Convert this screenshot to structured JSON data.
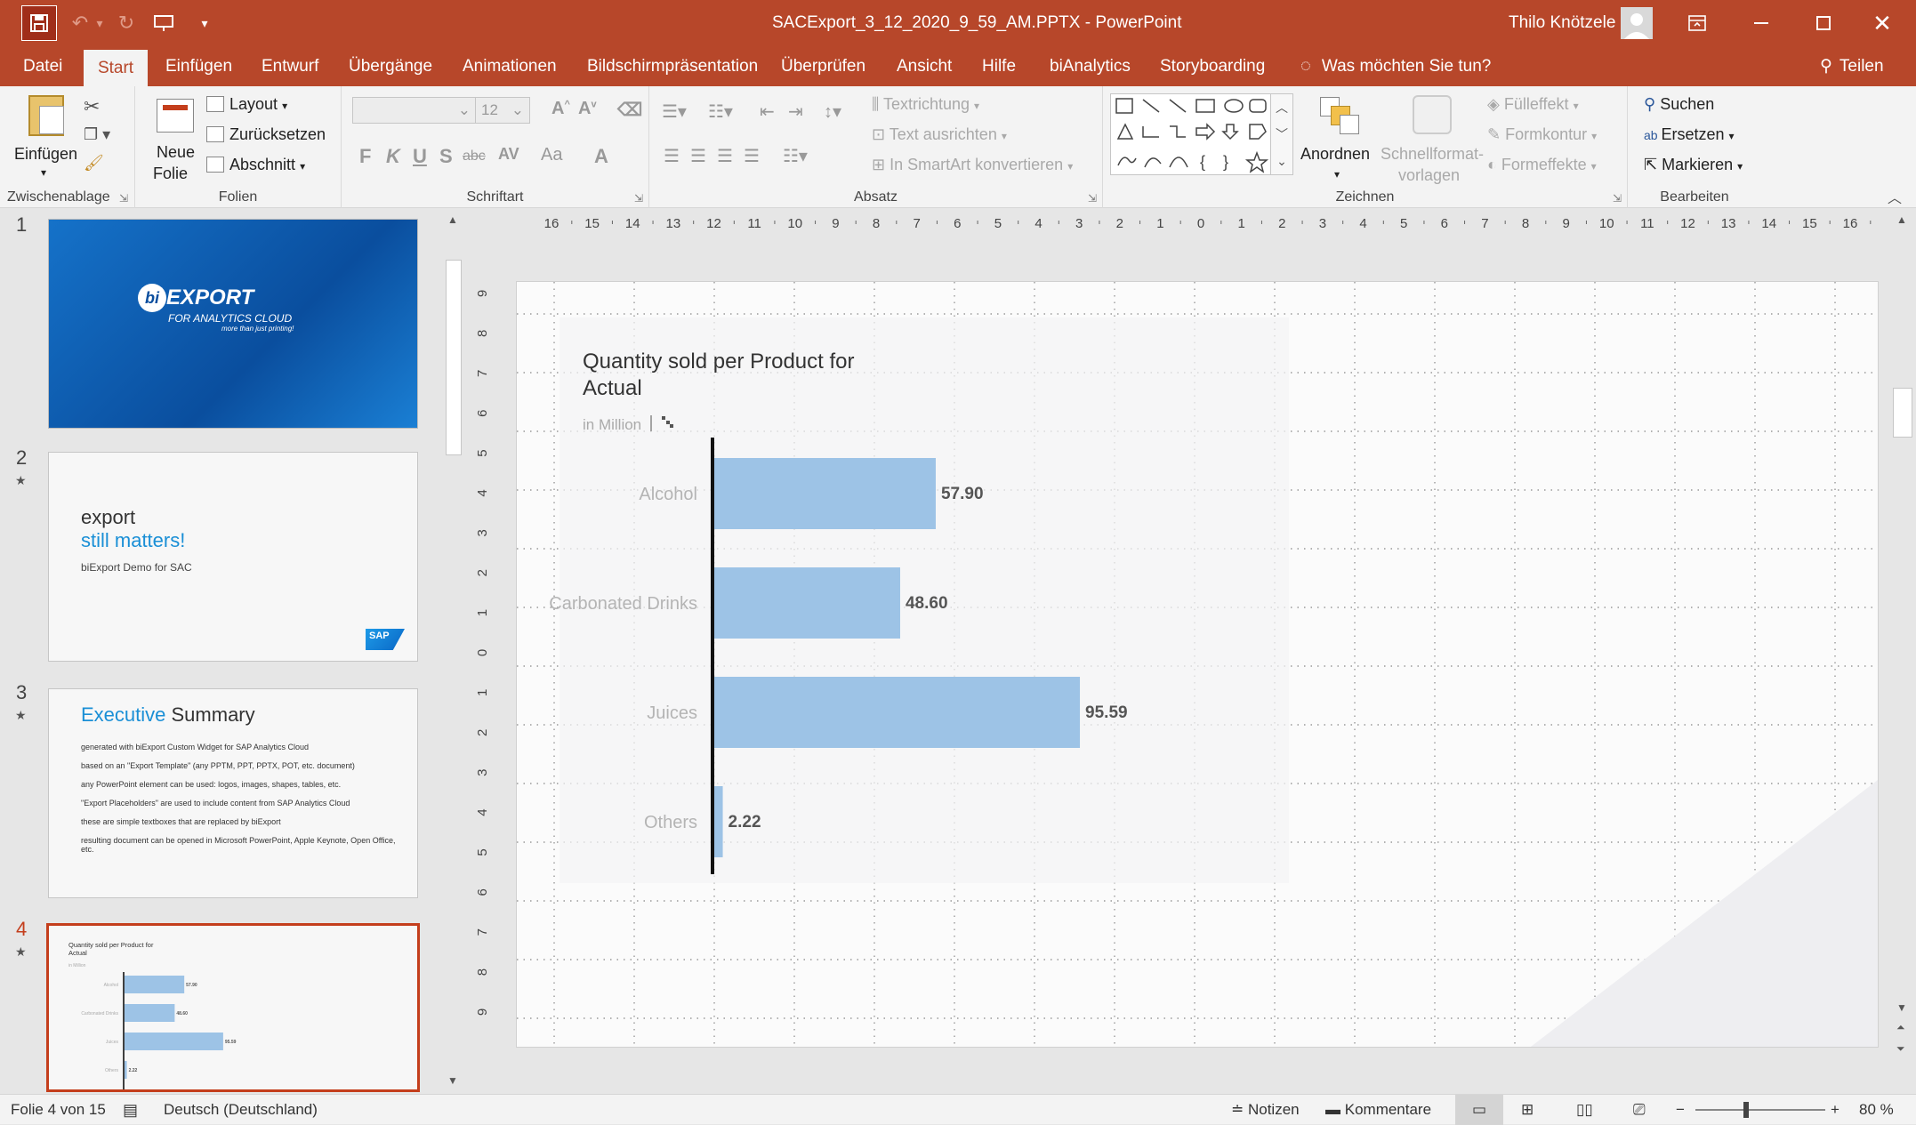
{
  "window": {
    "title": "SACExport_3_12_2020_9_59_AM.PPTX  -  PowerPoint",
    "user": "Thilo Knötzele"
  },
  "menu": {
    "tabs": [
      "Datei",
      "Start",
      "Einfügen",
      "Entwurf",
      "Übergänge",
      "Animationen",
      "Bildschirmpräsentation",
      "Überprüfen",
      "Ansicht",
      "Hilfe",
      "biAnalytics",
      "Storyboarding"
    ],
    "tellme": "Was möchten Sie tun?",
    "share": "Teilen",
    "active": "Start"
  },
  "ribbon": {
    "clipboard": {
      "paste": "Einfügen",
      "label": "Zwischenablage"
    },
    "slides": {
      "new_line1": "Neue",
      "new_line2": "Folie",
      "layout": "Layout",
      "reset": "Zurücksetzen",
      "section": "Abschnitt",
      "label": "Folien"
    },
    "font": {
      "size": "12",
      "label": "Schriftart",
      "bold": "F",
      "italic": "K",
      "underline": "U",
      "shadow": "S",
      "strike": "abc",
      "spacing": "AV",
      "case": "Aa",
      "color": "A"
    },
    "paragraph": {
      "textdir": "Textrichtung",
      "align": "Text ausrichten",
      "smartart": "In SmartArt konvertieren",
      "label": "Absatz"
    },
    "drawing": {
      "arrange": "Anordnen",
      "quick1": "Schnellformat-",
      "quick2": "vorlagen",
      "fill": "Fülleffekt",
      "outline": "Formkontur",
      "effects": "Formeffekte",
      "label": "Zeichnen"
    },
    "editing": {
      "find": "Suchen",
      "replace": "Ersetzen",
      "select": "Markieren",
      "label": "Bearbeiten"
    }
  },
  "thumbnails": [
    {
      "num": "1",
      "logo_main": "EXPORT",
      "logo_sub": "FOR ANALYTICS CLOUD",
      "logo_tag": "more than just printing!"
    },
    {
      "num": "2",
      "line1": "export",
      "line2": "still matters!",
      "line3": "biExport Demo for SAC",
      "sap": "SAP"
    },
    {
      "num": "3",
      "title_a": "Executive",
      "title_b": " Summary",
      "bullets": [
        "generated with biExport Custom Widget for SAP Analytics Cloud",
        "based on an \"Export Template\" (any PPTM, PPT, PPTX, POT, etc. document)",
        "any PowerPoint element can be used: logos, images, shapes, tables, etc.",
        "\"Export Placeholders\" are used to include content from SAP Analytics Cloud",
        "these are simple textboxes that are replaced by biExport",
        "resulting document can be opened in Microsoft PowerPoint, Apple Keynote, Open Office, etc."
      ]
    },
    {
      "num": "4"
    }
  ],
  "chart_data": {
    "type": "bar",
    "orientation": "horizontal",
    "title": "Quantity sold per Product for Actual",
    "subtitle": "in Million",
    "categories": [
      "Alcohol",
      "Carbonated Drinks",
      "Juices",
      "Others"
    ],
    "values": [
      57.9,
      48.6,
      95.59,
      2.22
    ],
    "labels": [
      "57.90",
      "48.60",
      "95.59",
      "2.22"
    ],
    "color": "#9dc3e6",
    "xlim": [
      0,
      100
    ],
    "grid": false,
    "legend": "none"
  },
  "ruler": {
    "h": [
      "16",
      "15",
      "14",
      "13",
      "12",
      "11",
      "10",
      "9",
      "8",
      "7",
      "6",
      "5",
      "4",
      "3",
      "2",
      "1",
      "0",
      "1",
      "2",
      "3",
      "4",
      "5",
      "6",
      "7",
      "8",
      "9",
      "10",
      "11",
      "12",
      "13",
      "14",
      "15",
      "16"
    ],
    "v": [
      "9",
      "8",
      "7",
      "6",
      "5",
      "4",
      "3",
      "2",
      "1",
      "0",
      "1",
      "2",
      "3",
      "4",
      "5",
      "6",
      "7",
      "8",
      "9"
    ]
  },
  "status": {
    "slide": "Folie 4 von 15",
    "lang": "Deutsch (Deutschland)",
    "notes": "Notizen",
    "comments": "Kommentare",
    "zoom": "80 %"
  },
  "colors": {
    "accent": "#b7472a",
    "selection": "#c43e1c",
    "bar": "#9dc3e6"
  }
}
